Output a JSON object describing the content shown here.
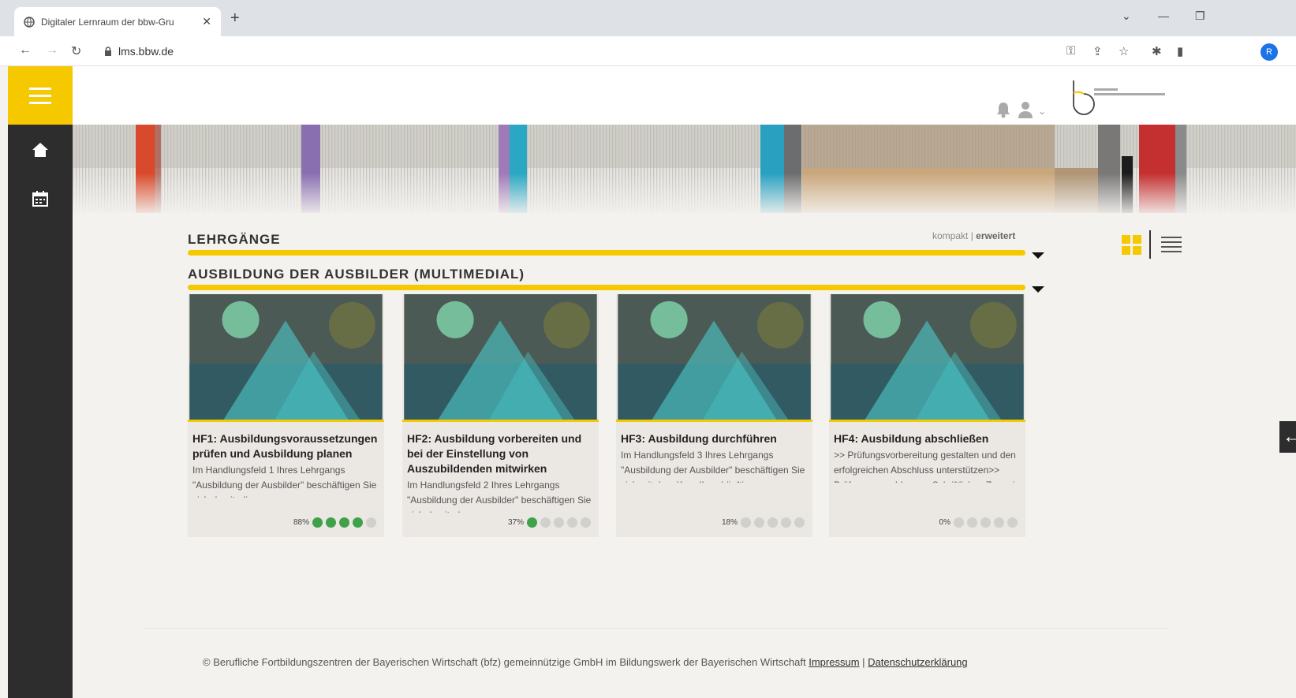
{
  "browser": {
    "tab_title": "Digitaler Lernraum der bbw-Gru",
    "url": "lms.bbw.de",
    "profile_initial": "R"
  },
  "content": {
    "heading": "LEHRGÄNGE",
    "view_compact": "kompakt",
    "view_separator": "|",
    "view_extended": "erweitert",
    "course_title": "AUSBILDUNG DER AUSBILDER (MULTIMEDIAL)",
    "cards": [
      {
        "title": "HF1: Ausbildungsvoraussetzungen prüfen und Ausbildung planen",
        "desc": "Im Handlungsfeld 1 Ihres Lehrgangs \"Ausbildung der Ausbilder\" beschäftigen Sie sich damit, die",
        "percent_label": "88%",
        "progress_pct": 88,
        "dots_filled": 4
      },
      {
        "title": "HF2: Ausbildung vorbereiten und bei der Einstellung von Auszubildenden mitwirken",
        "desc": "Im Handlungsfeld 2 Ihres Lehrgangs \"Ausbildung der Ausbilder\" beschäftigen Sie sich damit, den",
        "percent_label": "37%",
        "progress_pct": 37,
        "dots_filled": 1
      },
      {
        "title": "HF3: Ausbildung durchführen",
        "desc": "Im Handlungsfeld 3 Ihres Lehrgangs \"Ausbildung der Ausbilder\" beschäftigen Sie sich mit dem Kern Ihrer künftigen Ausbildungstätigkeit: der konkreten Durchführung der",
        "percent_label": "18%",
        "progress_pct": 18,
        "dots_filled": 0
      },
      {
        "title": "HF4: Ausbildung abschließen",
        "desc": ">> Prüfungsvorbereitung gestalten und den erfolgreichen Abschluss unterstützen>> Prüfungsanmeldung>> Schriftliches Zeugnis erstellen>> Betriebliche und berufliche",
        "percent_label": "0%",
        "progress_pct": 0,
        "dots_filled": 0
      }
    ]
  },
  "footer": {
    "text": "© Berufliche Fortbildungszentren der Bayerischen Wirtschaft (bfz) gemeinnützige GmbH im Bildungswerk der Bayerischen Wirtschaft",
    "impressum": "Impressum",
    "separator": "|",
    "datenschutz": "Datenschutzerklärung"
  },
  "colors": {
    "accent_yellow": "#f5c800",
    "sidebar_dark": "#2d2d2d",
    "progress_green": "#3fa14a"
  },
  "icons": {
    "sidebar": [
      "menu-icon",
      "home-icon",
      "calendar-icon"
    ],
    "header": [
      "bell-icon",
      "user-icon",
      "chevron-down-icon"
    ]
  }
}
